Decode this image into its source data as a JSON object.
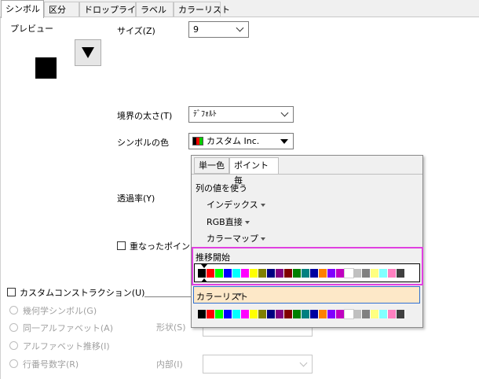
{
  "tabs": [
    "シンボル",
    "区分",
    "ドロップライン",
    "ラベル",
    "カラーリスト"
  ],
  "preview": {
    "label": "プレビュー"
  },
  "size": {
    "label": "サイズ(Z)",
    "value": "9"
  },
  "border": {
    "label": "境界の太さ(T)",
    "value": "ﾃﾞﾌｫﾙﾄ"
  },
  "symbol_color": {
    "label": "シンボルの色",
    "value": "カスタム Inc."
  },
  "transparency": {
    "label": "透過率(Y)"
  },
  "overlap": {
    "label": "重なったポイント"
  },
  "custom_construction": {
    "label": "カスタムコンストラクション(U)"
  },
  "radios": [
    "幾何学シンボル(G)",
    "同一アルファベット(A)",
    "アルファベット推移(I)",
    "行番号数字(R)"
  ],
  "shape": {
    "label": "形状(S)"
  },
  "interior": {
    "label": "内部(I)"
  },
  "popup": {
    "tabs": [
      "単一色",
      "ポイント毎"
    ],
    "use_column": "列の値を使う",
    "items": [
      "インデックス",
      "RGB直接",
      "カラーマップ"
    ],
    "increment_start": "推移開始",
    "color_list": "カラーリスト"
  },
  "colors": [
    "#000000",
    "#ff0000",
    "#00ff00",
    "#0000ff",
    "#00ffff",
    "#ff00ff",
    "#ffff00",
    "#808000",
    "#000080",
    "#800080",
    "#800000",
    "#008000",
    "#008080",
    "#0000a0",
    "#ff8000",
    "#8000ff",
    "#c000c0",
    "#ffffff",
    "#c0c0c0",
    "#808080",
    "#ffff80",
    "#80ffff",
    "#ff80c0",
    "#404040"
  ],
  "highlight_color": "#e040e0",
  "selected_bg": "#fde8c8"
}
